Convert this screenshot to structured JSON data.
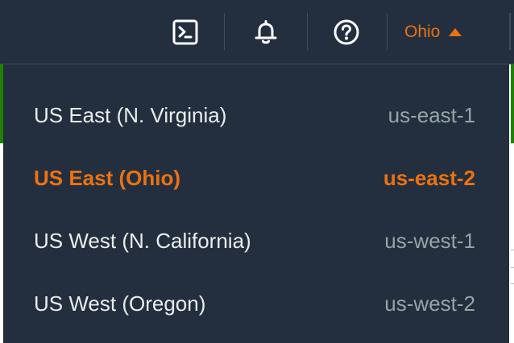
{
  "header": {
    "cloudshell_icon": "cloudshell-icon",
    "notifications_icon": "bell-icon",
    "help_icon": "help-icon",
    "region_label": "Ohio",
    "region_caret_icon": "caret-up-icon"
  },
  "region_menu": {
    "items": [
      {
        "name": "US East (N. Virginia)",
        "code": "us-east-1",
        "selected": false
      },
      {
        "name": "US East (Ohio)",
        "code": "us-east-2",
        "selected": true
      },
      {
        "name": "US West (N. California)",
        "code": "us-west-1",
        "selected": false
      },
      {
        "name": "US West (Oregon)",
        "code": "us-west-2",
        "selected": false
      }
    ]
  },
  "colors": {
    "nav_background": "#232f3e",
    "accent": "#ec7211",
    "text_primary": "#eaeded",
    "text_secondary": "#95a5a6",
    "divider": "#414d5c",
    "page_green": "#1d8102"
  }
}
